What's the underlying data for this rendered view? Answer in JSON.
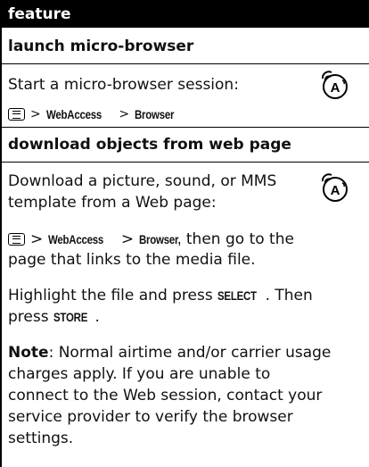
{
  "table": {
    "header": "feature",
    "section1": {
      "title": "launch micro-browser",
      "text": "Start a micro-browser session:",
      "menu": {
        "sep": ">",
        "item1": "WebAccess",
        "item2": "Browser"
      }
    },
    "section2": {
      "title": "download objects from web page",
      "text_line1": "Download a picture, sound, or MMS",
      "text_line2": "template from a Web page:",
      "menu": {
        "sep": ">",
        "item1": "WebAccess",
        "item2": "Browser,",
        "rest": "then go to the"
      },
      "menu_line2": "page that links to the media file.",
      "highlight_pre": "Highlight the file and press",
      "highlight_key1": "SELECT",
      "highlight_mid": ". Then",
      "highlight_line2_pre": "press",
      "highlight_key2": "STORE",
      "highlight_end": ".",
      "note_label": "Note",
      "note_line1": ": Normal airtime and/or carrier usage",
      "note_line2": "charges apply. If you are unable to",
      "note_line3": "connect to the Web session, contact your",
      "note_line4": "service provider to verify the browser",
      "note_line5": "settings."
    }
  }
}
